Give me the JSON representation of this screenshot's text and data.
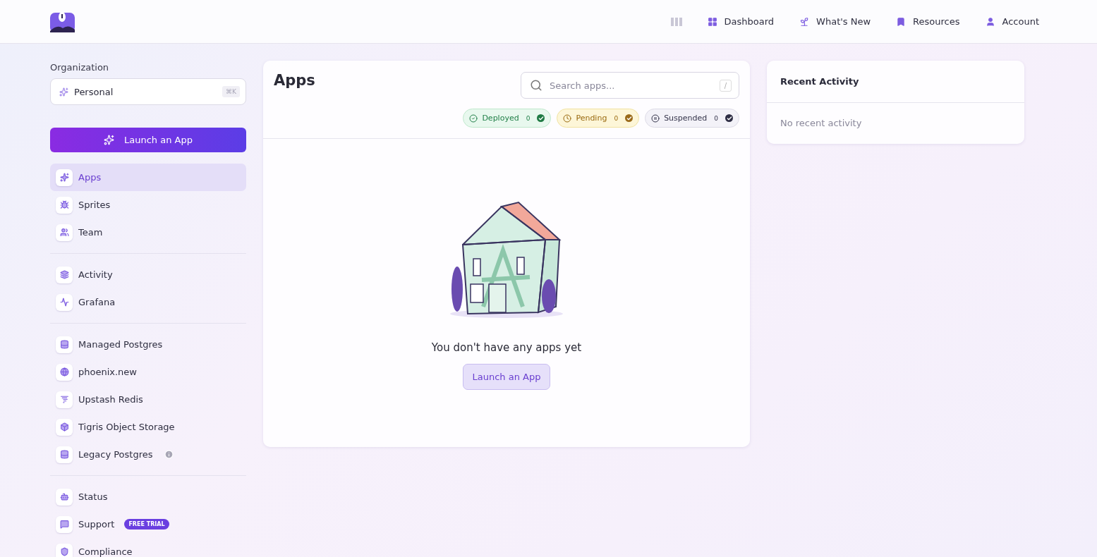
{
  "header": {
    "nav": [
      {
        "label": "Dashboard"
      },
      {
        "label": "What's New"
      },
      {
        "label": "Resources"
      },
      {
        "label": "Account"
      }
    ]
  },
  "sidebar": {
    "org_label": "Organization",
    "org_select": {
      "value": "Personal",
      "shortcut": "⌘K"
    },
    "launch_button": "Launch an App",
    "groups": [
      {
        "items": [
          {
            "label": "Apps",
            "selected": true
          },
          {
            "label": "Sprites",
            "selected": false
          },
          {
            "label": "Team",
            "selected": false
          }
        ]
      },
      {
        "items": [
          {
            "label": "Activity",
            "selected": false
          },
          {
            "label": "Grafana",
            "selected": false
          }
        ]
      },
      {
        "items": [
          {
            "label": "Managed Postgres",
            "selected": false
          },
          {
            "label": "phoenix.new",
            "selected": false
          },
          {
            "label": "Upstash Redis",
            "selected": false
          },
          {
            "label": "Tigris Object Storage",
            "selected": false
          },
          {
            "label": "Legacy Postgres",
            "selected": false,
            "info": true
          }
        ]
      },
      {
        "items": [
          {
            "label": "Status",
            "selected": false
          },
          {
            "label": "Support",
            "selected": false,
            "badge": "FREE TRIAL"
          },
          {
            "label": "Compliance",
            "selected": false
          }
        ]
      }
    ]
  },
  "apps_panel": {
    "title": "Apps",
    "search": {
      "placeholder": "Search apps...",
      "shortcut": "/"
    },
    "filters": [
      {
        "kind": "deployed",
        "label": "Deployed",
        "count": "0"
      },
      {
        "kind": "pending",
        "label": "Pending",
        "count": "0"
      },
      {
        "kind": "suspended",
        "label": "Suspended",
        "count": "0"
      }
    ],
    "empty_message": "You don't have any apps yet",
    "launch_button": "Launch an App"
  },
  "recent_activity": {
    "title": "Recent Activity",
    "empty_message": "No recent activity"
  }
}
